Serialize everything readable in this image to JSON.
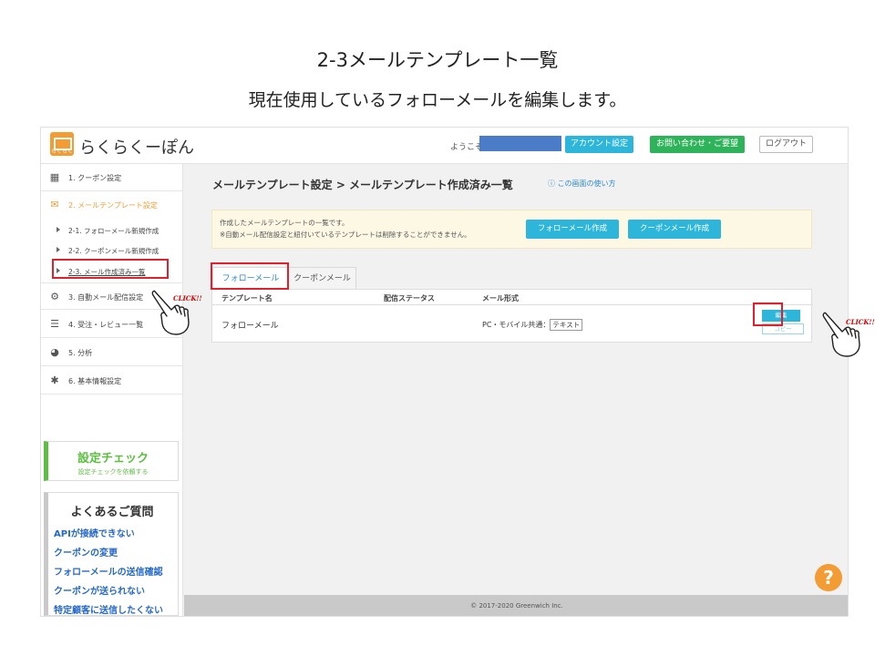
{
  "slide": {
    "title": "2-3メールテンプレート一覧",
    "subtitle": "現在使用しているフォローメールを編集します。"
  },
  "header": {
    "logo_text": "らくらくーぽん",
    "logo_badge": "らくらく",
    "greeting": "ようこそ.",
    "account_button": "アカウント設定",
    "contact_button": "お問い合わせ・ご要望",
    "logout_button": "ログアウト"
  },
  "sidebar": {
    "items": [
      {
        "icon": "coupon-icon",
        "label": "1. クーポン設定"
      },
      {
        "icon": "mail-icon",
        "label": "2. メールテンプレート設定"
      },
      {
        "icon": "auto-mail-icon",
        "label": "3. 自動メール配信設定"
      },
      {
        "icon": "list-icon",
        "label": "4. 受注・レビュー一覧"
      },
      {
        "icon": "pie-chart-icon",
        "label": "5. 分析"
      },
      {
        "icon": "gear-icon",
        "label": "6. 基本情報設定"
      }
    ],
    "subitems": [
      {
        "label": "2-1. フォローメール新規作成"
      },
      {
        "label": "2-2. クーポンメール新規作成"
      },
      {
        "label": "2-3. メール作成済み一覧"
      }
    ],
    "check": {
      "title": "設定チェック",
      "subtitle": "設定チェックを依頼する"
    },
    "faq": {
      "title": "よくあるご質問",
      "items": [
        "APIが接続できない",
        "クーポンの変更",
        "フォローメールの送信確認",
        "クーポンが送られない",
        "特定顧客に送信したくない"
      ]
    }
  },
  "main": {
    "breadcrumb": "メールテンプレート設定 > メールテンプレート作成済み一覧",
    "help_link": "この画面の使い方",
    "notice": {
      "line1": "作成したメールテンプレートの一覧です。",
      "line2": "※自動メール配信設定と紐付いているテンプレートは削除することができません。"
    },
    "create_follow_button": "フォローメール作成",
    "create_coupon_button": "クーポンメール作成",
    "tabs": [
      {
        "label": "フォローメール"
      },
      {
        "label": "クーポンメール"
      }
    ],
    "table": {
      "headers": [
        "テンプレート名",
        "配信ステータス",
        "メール形式"
      ],
      "rows": [
        {
          "name": "フォローメール",
          "status": "",
          "format_prefix": "PC・モバイル共通：",
          "format_badge": "テキスト"
        }
      ],
      "edit_button": "編集",
      "copy_button": "コピー"
    },
    "footer": "© 2017-2020 Greenwich Inc."
  },
  "annotations": {
    "click_label": "CLICK!!",
    "help_symbol": "?"
  },
  "colors": {
    "accent": "#2db6d9",
    "brand": "#f39c33",
    "green": "#2fb35a",
    "highlight": "#e0202c",
    "link": "#2568c7"
  }
}
